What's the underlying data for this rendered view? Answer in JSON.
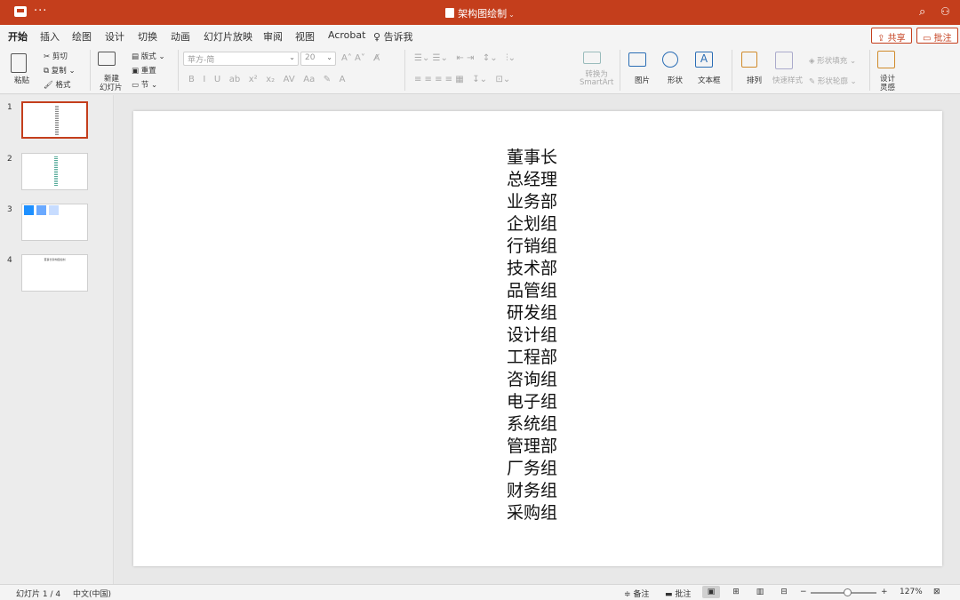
{
  "titlebar": {
    "more": "···",
    "doc_title": "架构图绘制",
    "caret": "⌄"
  },
  "tabs": [
    "开始",
    "插入",
    "绘图",
    "设计",
    "切换",
    "动画",
    "幻灯片放映",
    "审阅",
    "视图",
    "Acrobat",
    "告诉我"
  ],
  "share_label": "共享",
  "comment_label": "批注",
  "ribbon": {
    "paste": "粘贴",
    "cut": "剪切",
    "copy": "复制",
    "format": "格式",
    "new_slide_line1": "新建",
    "new_slide_line2": "幻灯片",
    "layout": "版式",
    "reset": "重置",
    "section": "节",
    "font_name": "苹方-简",
    "font_size": "20",
    "convert_line1": "转换为",
    "convert_line2": "SmartArt",
    "picture": "图片",
    "shape": "形状",
    "textbox": "文本框",
    "arrange": "排列",
    "quick_styles": "快速样式",
    "shape_fill": "形状填充",
    "shape_outline": "形状轮廓",
    "designer_line1": "设计",
    "designer_line2": "灵感"
  },
  "slides": [
    {
      "number": "1"
    },
    {
      "number": "2"
    },
    {
      "number": "3"
    },
    {
      "number": "4",
      "thumb_title": "董事长架构图绘制"
    }
  ],
  "slide_content": {
    "items": [
      "董事长",
      "总经理",
      "业务部",
      "企划组",
      "行销组",
      "技术部",
      "品管组",
      "研发组",
      "设计组",
      "工程部",
      "咨询组",
      "电子组",
      "系统组",
      "管理部",
      "厂务组",
      "财务组",
      "采购组"
    ]
  },
  "status": {
    "slide_info": "幻灯片 1 / 4",
    "language": "中文(中国)",
    "notes": "备注",
    "comments": "批注",
    "zoom": "127%",
    "zoom_level_percent": 127
  },
  "colors": {
    "accent": "#c43e1c"
  }
}
